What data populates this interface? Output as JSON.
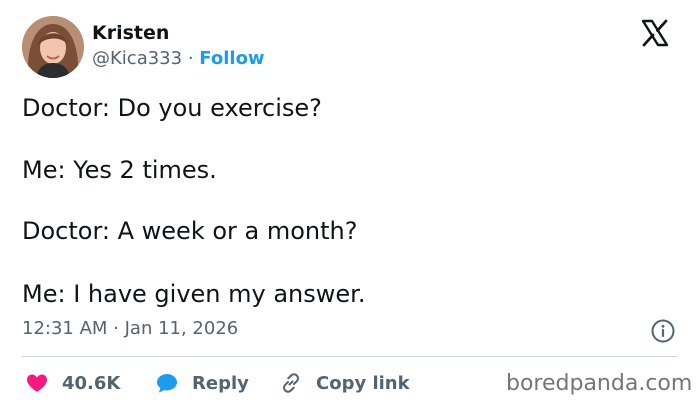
{
  "author": {
    "name": "Kristen",
    "handle": "@Kica333",
    "separator": "·",
    "follow_label": "Follow"
  },
  "tweet": {
    "lines": [
      "Doctor: Do you exercise?",
      "Me: Yes 2 times.",
      "Doctor: A week or a month?",
      "Me: I have given my answer."
    ],
    "timestamp": "12:31 AM · Jan 11, 2026"
  },
  "actions": {
    "like_count": "40.6K",
    "reply_label": "Reply",
    "copy_link_label": "Copy link"
  },
  "watermark": "boredpanda.com",
  "icons": {
    "brand": "x-logo-icon",
    "info": "info-icon",
    "like": "heart-icon",
    "reply": "reply-bubble-icon",
    "copy": "link-icon"
  },
  "colors": {
    "text": "#0f1419",
    "secondary": "#536471",
    "accent": "#1d9bf0",
    "like": "#f91880",
    "divider": "#cfd9de"
  }
}
